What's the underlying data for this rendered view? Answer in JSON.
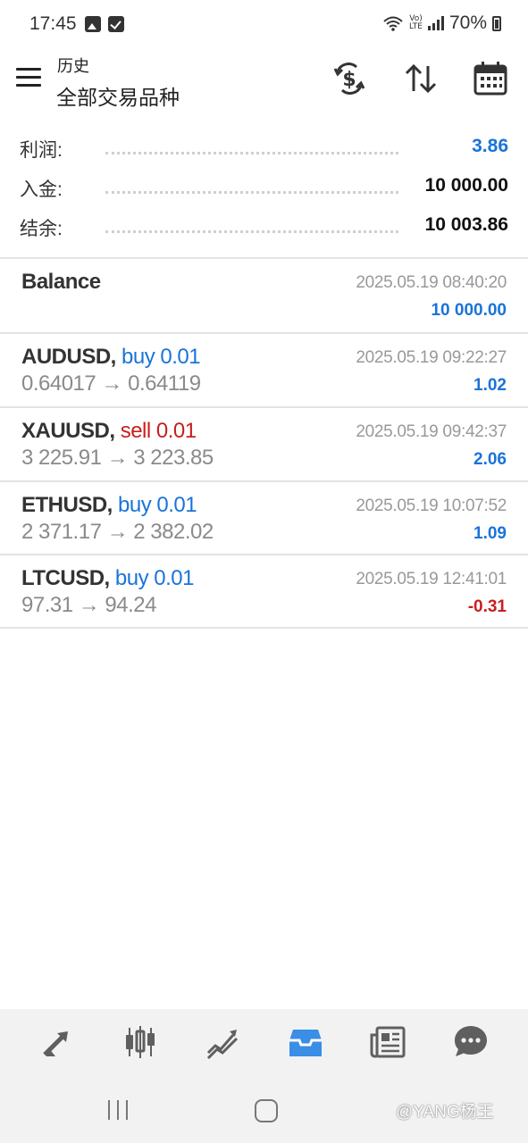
{
  "status_bar": {
    "time": "17:45",
    "network_top": "Vo)",
    "network_bottom": "LTE",
    "battery": "70%"
  },
  "app_bar": {
    "subtitle": "历史",
    "title": "全部交易品种"
  },
  "summary": [
    {
      "label": "利润:",
      "value": "3.86",
      "highlight": true
    },
    {
      "label": "入金:",
      "value": "10 000.00",
      "highlight": false
    },
    {
      "label": "结余:",
      "value": "10 003.86",
      "highlight": false
    }
  ],
  "balance": {
    "label": "Balance",
    "time": "2025.05.19 08:40:20",
    "amount": "10 000.00"
  },
  "deals": [
    {
      "symbol": "AUDUSD,",
      "type": "buy 0.01",
      "side": "buy",
      "prices": "0.64017 → 0.64119",
      "time": "2025.05.19 09:22:27",
      "profit": "1.02"
    },
    {
      "symbol": "XAUUSD,",
      "type": "sell 0.01",
      "side": "sell",
      "prices": "3 225.91 → 3 223.85",
      "time": "2025.05.19 09:42:37",
      "profit": "2.06"
    },
    {
      "symbol": "ETHUSD,",
      "type": "buy 0.01",
      "side": "buy",
      "prices": "2 371.17 → 2 382.02",
      "time": "2025.05.19 10:07:52",
      "profit": "1.09"
    },
    {
      "symbol": "LTCUSD,",
      "type": "buy 0.01",
      "side": "buy",
      "prices": "97.31 → 94.24",
      "time": "2025.05.19 12:41:01",
      "profit": "-0.31"
    }
  ],
  "bottom_nav": [
    {
      "icon": "quotes-icon",
      "active": false
    },
    {
      "icon": "chart-candles-icon",
      "active": false
    },
    {
      "icon": "trade-icon",
      "active": false
    },
    {
      "icon": "history-inbox-icon",
      "active": true
    },
    {
      "icon": "news-icon",
      "active": false
    },
    {
      "icon": "chat-icon",
      "active": false
    }
  ],
  "watermark": "@YANG杨王",
  "colors": {
    "accent_blue": "#1a73d9",
    "sell_red": "#c81e1e",
    "nav_background": "#f2f2f2"
  }
}
